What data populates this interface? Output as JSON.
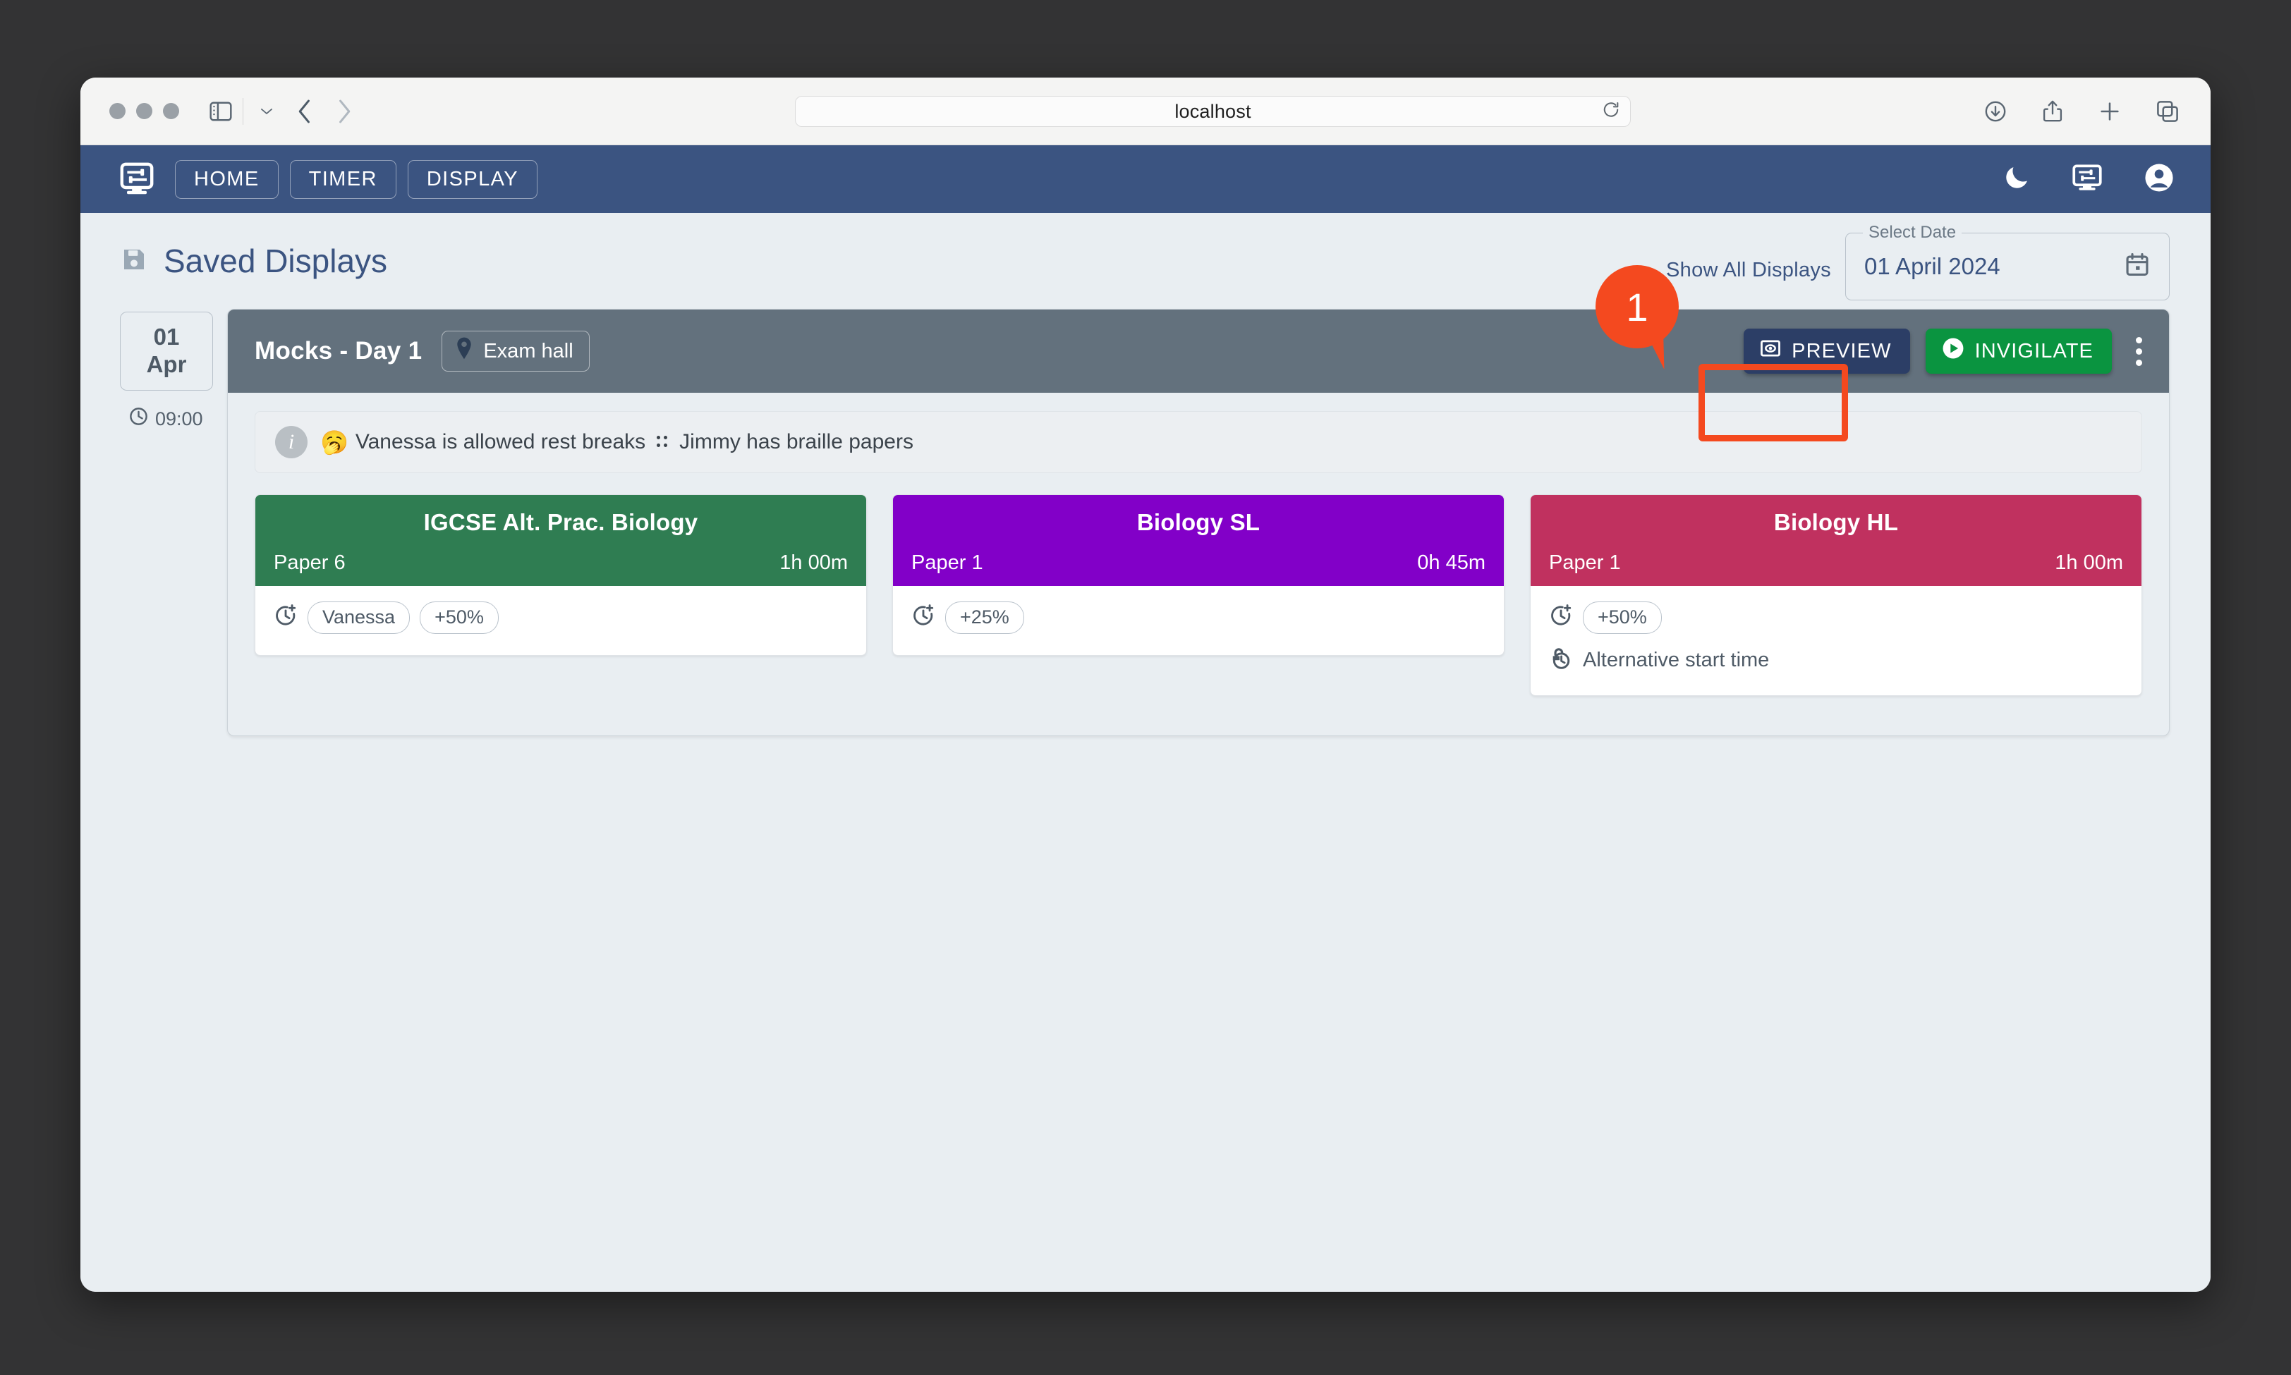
{
  "browser": {
    "url": "localhost",
    "traffic_lights": [
      "close-button",
      "minimize-button",
      "maximize-button"
    ],
    "toolbar_icons": [
      "sidebar-toggle-icon",
      "chevron-down-icon",
      "back-arrow-icon",
      "forward-arrow-icon",
      "reload-icon"
    ],
    "right_icons": [
      "downloads-icon",
      "share-icon",
      "new-tab-icon",
      "tab-overview-icon"
    ]
  },
  "navbar": {
    "logo_icon": "monitor-sliders-icon",
    "items": [
      {
        "label": "HOME",
        "name": "nav-home"
      },
      {
        "label": "TIMER",
        "name": "nav-timer"
      },
      {
        "label": "DISPLAY",
        "name": "nav-display"
      }
    ],
    "right_icons": [
      "dark-mode-moon-icon",
      "display-monitor-icon",
      "account-circle-icon"
    ]
  },
  "header": {
    "title": "Saved Displays",
    "title_icon": "save-floppy-icon",
    "show_all_label": "Show All Displays",
    "date_field": {
      "label": "Select Date",
      "value": "01 April 2024",
      "icon": "calendar-icon"
    }
  },
  "day_column": {
    "day": "01",
    "month": "Apr",
    "time": "09:00",
    "time_icon": "clock-icon"
  },
  "panel": {
    "title": "Mocks - Day 1",
    "location": "Exam hall",
    "location_icon": "map-pin-icon",
    "preview_label": "PREVIEW",
    "preview_icon": "preview-eye-icon",
    "invigilate_label": "INVIGILATE",
    "invigilate_icon": "play-circle-icon",
    "kebab_icon": "more-vertical-icon",
    "info": {
      "icon": "info-circle-icon",
      "emoji": "🥱",
      "text_1": "Vanessa is allowed rest breaks",
      "braille_icon": "braille-dots-icon",
      "text_2": "Jimmy has braille papers"
    }
  },
  "exam_cards": [
    {
      "subject": "IGCSE Alt. Prac. Biology",
      "paper": "Paper 6",
      "duration": "1h 00m",
      "color": "#2f7d52",
      "rows": [
        {
          "icon": "extra-time-clock-icon",
          "pills": [
            "Vanessa",
            "+50%"
          ],
          "label": ""
        }
      ]
    },
    {
      "subject": "Biology SL",
      "paper": "Paper 1",
      "duration": "0h 45m",
      "color": "#8200c8",
      "rows": [
        {
          "icon": "extra-time-clock-icon",
          "pills": [
            "+25%"
          ],
          "label": ""
        }
      ]
    },
    {
      "subject": "Biology HL",
      "paper": "Paper 1",
      "duration": "1h 00m",
      "color": "#c0315f",
      "rows": [
        {
          "icon": "extra-time-clock-icon",
          "pills": [
            "+50%"
          ],
          "label": ""
        },
        {
          "icon": "alternative-start-time-icon",
          "pills": [],
          "label": "Alternative start time"
        }
      ]
    }
  ],
  "annotation": {
    "step_number": "1",
    "accent_color": "#f4491f",
    "highlights": "preview-button"
  },
  "colors": {
    "navbar": "#3b5481",
    "app_background": "#e9eef2",
    "panel_header": "#63717d",
    "preview_button": "#2c3e66",
    "invigilate_button": "#0a9440"
  }
}
